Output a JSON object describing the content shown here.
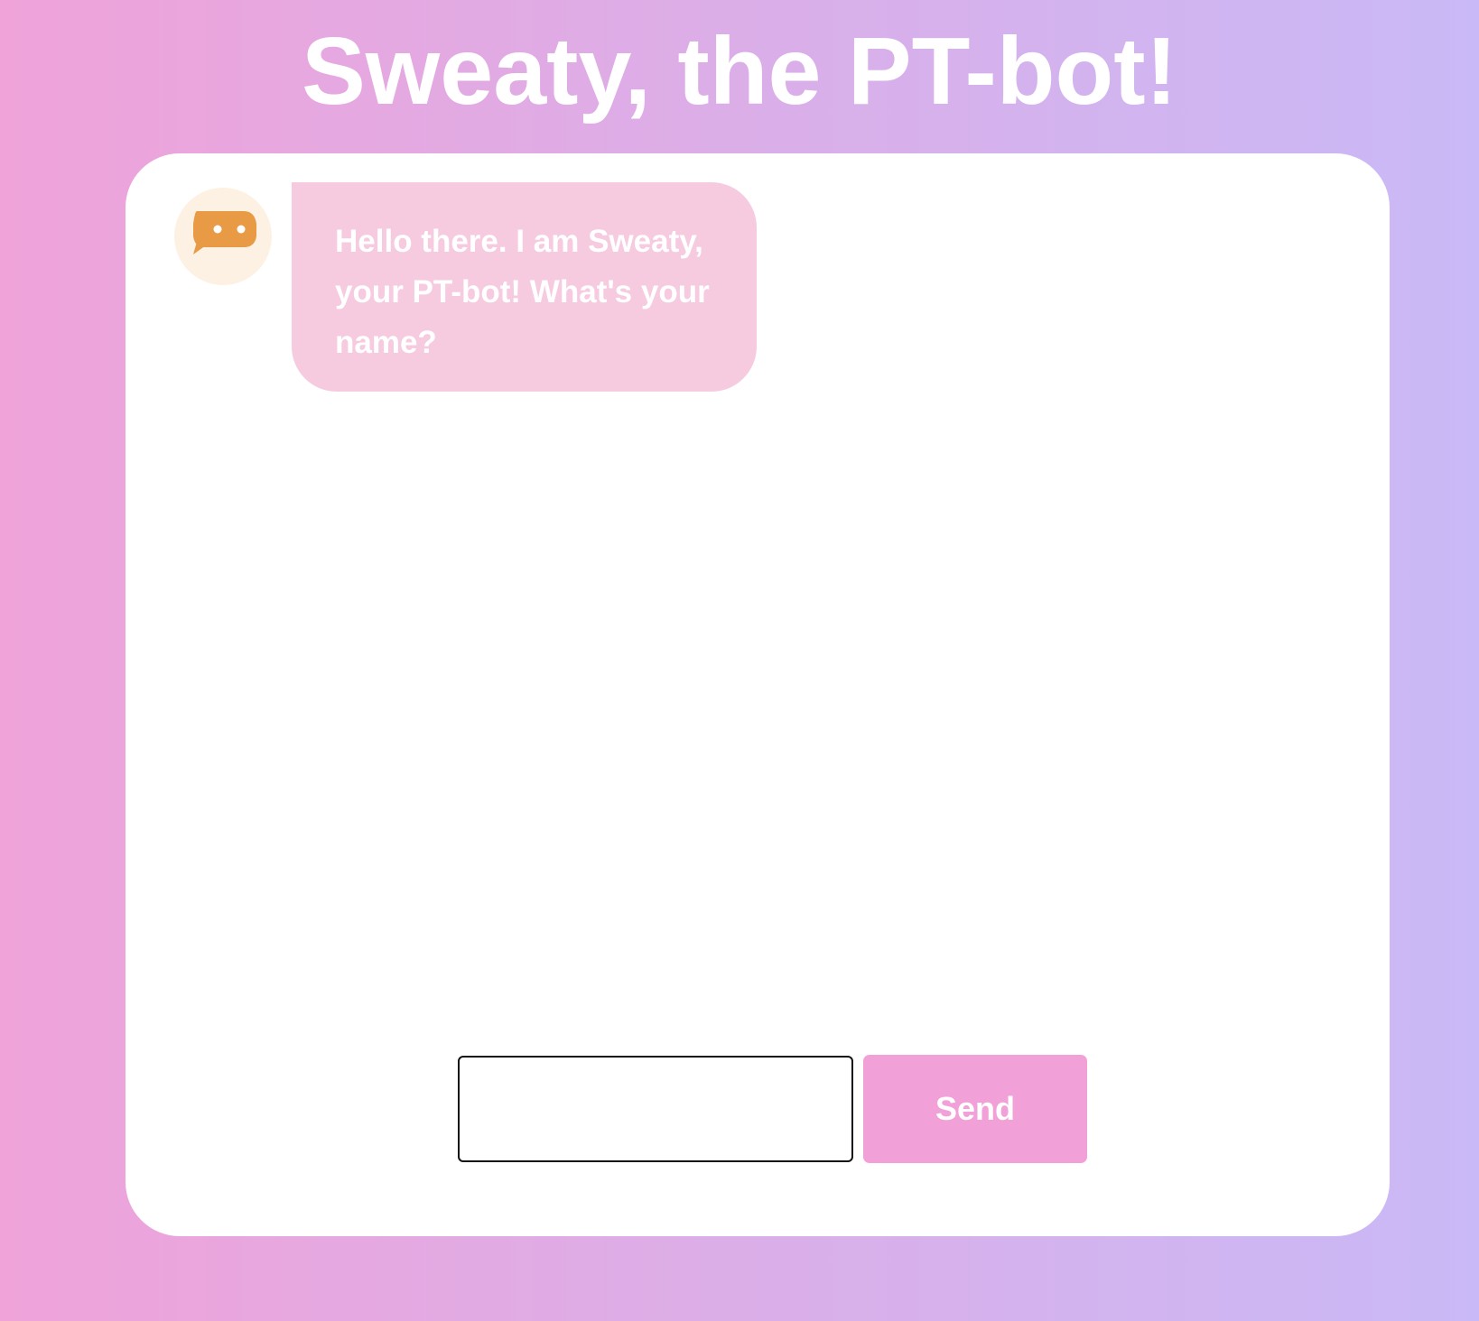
{
  "header": {
    "title": "Sweaty, the PT-bot!"
  },
  "chat": {
    "bot_avatar_icon": "chat-bubble-icon",
    "messages": [
      {
        "sender": "bot",
        "text": "Hello there. I am Sweaty, your PT-bot! What's your name?"
      }
    ]
  },
  "composer": {
    "input_value": "",
    "send_label": "Send"
  },
  "colors": {
    "accent": "#f1a1d7",
    "bubble": "#f6cbe0",
    "avatar_bg": "#fdf1e4",
    "avatar_icon": "#e89a45",
    "gradient_start": "#efa3d9",
    "gradient_end": "#c9b9f6"
  }
}
